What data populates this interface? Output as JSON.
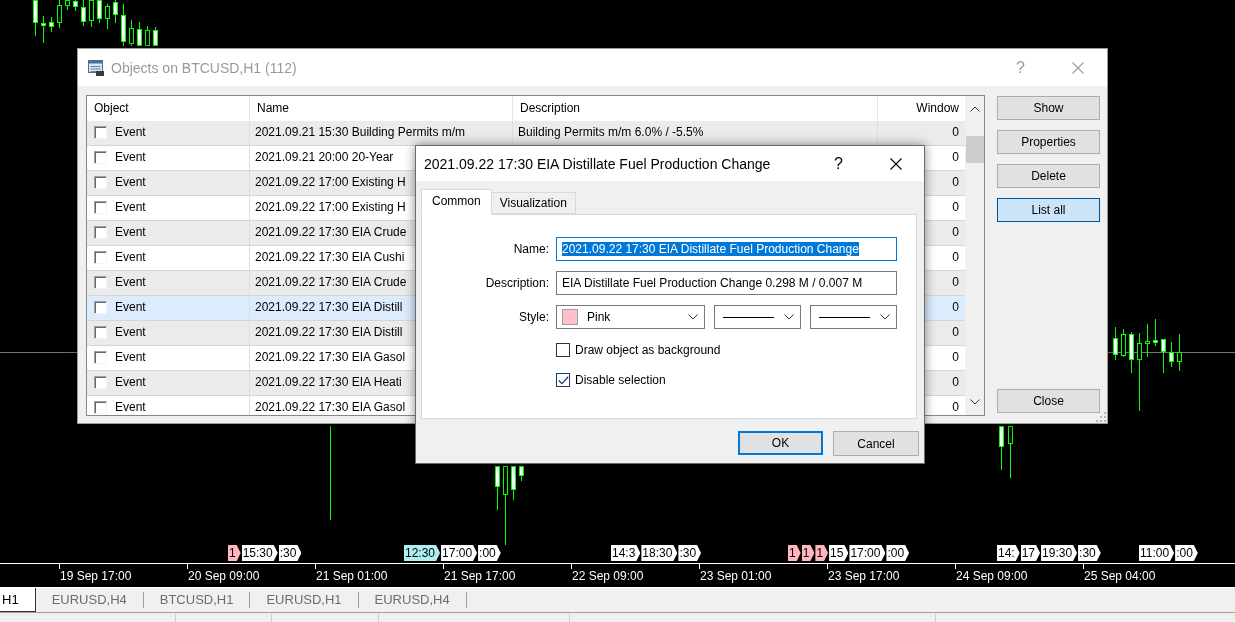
{
  "objects_window": {
    "title": "Objects on BTCUSD,H1 (112)",
    "active": false,
    "help": "?",
    "columns": [
      "Object",
      "Name",
      "Description",
      "Window"
    ],
    "rows": [
      {
        "object": "Event",
        "checked": false,
        "name": "2021.09.21 15:30 Building Permits m/m",
        "description": "Building Permits m/m 6.0% / -5.5%",
        "window": "0",
        "selected": false
      },
      {
        "object": "Event",
        "checked": false,
        "name": "2021.09.21 20:00 20-Year",
        "window": "0",
        "selected": false
      },
      {
        "object": "Event",
        "checked": false,
        "name": "2021.09.22 17:00 Existing H",
        "window": "0",
        "selected": false
      },
      {
        "object": "Event",
        "checked": false,
        "name": "2021.09.22 17:00 Existing H",
        "window": "0",
        "selected": false
      },
      {
        "object": "Event",
        "checked": false,
        "name": "2021.09.22 17:30 EIA Crude",
        "window": "0",
        "selected": false
      },
      {
        "object": "Event",
        "checked": false,
        "name": "2021.09.22 17:30 EIA Cushi",
        "window": "0",
        "selected": false
      },
      {
        "object": "Event",
        "checked": false,
        "name": "2021.09.22 17:30 EIA Crude",
        "window": "0",
        "selected": false
      },
      {
        "object": "Event",
        "checked": false,
        "name": "2021.09.22 17:30 EIA Distill",
        "window": "0",
        "selected": true
      },
      {
        "object": "Event",
        "checked": false,
        "name": "2021.09.22 17:30 EIA Distill",
        "window": "0",
        "selected": false
      },
      {
        "object": "Event",
        "checked": false,
        "name": "2021.09.22 17:30 EIA Gasol",
        "window": "0",
        "selected": false
      },
      {
        "object": "Event",
        "checked": false,
        "name": "2021.09.22 17:30 EIA Heati",
        "window": "0",
        "selected": false
      },
      {
        "object": "Event",
        "checked": false,
        "name": "2021.09.22 17:30 EIA Gasol",
        "window": "0",
        "selected": false
      }
    ],
    "buttons": [
      {
        "label": "Show",
        "focused": false
      },
      {
        "label": "Properties",
        "focused": false
      },
      {
        "label": "Delete",
        "focused": false
      },
      {
        "label": "List all",
        "focused": true
      },
      {
        "label": "Close",
        "focused": false
      }
    ]
  },
  "properties_dialog": {
    "title": "2021.09.22 17:30 EIA Distillate Fuel Production Change",
    "active": true,
    "help": "?",
    "tabs": [
      {
        "label": "Common",
        "selected": true
      },
      {
        "label": "Visualization",
        "selected": false
      }
    ],
    "fields": [
      {
        "label": "Name:",
        "value": "2021.09.22 17:30 EIA Distillate Fuel Production Change",
        "focused": true,
        "text_selected": true
      },
      {
        "label": "Description:",
        "value": "EIA Distillate Fuel Production Change 0.298 M / 0.007 M",
        "focused": false,
        "text_selected": false
      }
    ],
    "style": {
      "label": "Style:",
      "dropdowns": [
        {
          "kind": "color",
          "value": "Pink",
          "color": "#ffc0cb"
        },
        {
          "kind": "line"
        },
        {
          "kind": "line"
        }
      ]
    },
    "checkboxes": [
      {
        "label": "Draw object as background",
        "checked": false
      },
      {
        "label": "Disable selection",
        "checked": true
      }
    ],
    "buttons": [
      {
        "label": "OK",
        "default": true
      },
      {
        "label": "Cancel",
        "default": false
      }
    ]
  },
  "chart": {
    "event_tags": [
      {
        "items": [
          {
            "text": "1",
            "color": "#ffb6c1"
          },
          {
            "text": "15:30",
            "color": "#ffffff"
          },
          {
            "text": ":30",
            "color": "#ffffff"
          }
        ]
      },
      {
        "items": [
          {
            "text": "12:30",
            "color": "#afeeee"
          },
          {
            "text": "17:00",
            "color": "#ffffff"
          },
          {
            "text": ":00",
            "color": "#ffffff"
          }
        ]
      },
      {
        "items": [
          {
            "text": "14:3",
            "color": "#ffffff"
          },
          {
            "text": "18:30",
            "color": "#ffffff"
          },
          {
            "text": ":30",
            "color": "#ffffff"
          }
        ]
      },
      {
        "items": [
          {
            "text": "1",
            "color": "#ffb6c1"
          },
          {
            "text": "1",
            "color": "#ffb6c1"
          },
          {
            "text": "1",
            "color": "#ffb6c1"
          },
          {
            "text": "15",
            "color": "#ffffff"
          },
          {
            "text": "17:00",
            "color": "#ffffff"
          },
          {
            "text": ":00",
            "color": "#ffffff"
          }
        ]
      },
      {
        "items": [
          {
            "text": "14:",
            "color": "#ffffff"
          },
          {
            "text": "17",
            "color": "#ffffff"
          },
          {
            "text": "19:30",
            "color": "#ffffff"
          },
          {
            "text": ":30",
            "color": "#ffffff"
          }
        ]
      },
      {
        "items": [
          {
            "text": "11:00",
            "color": "#ffffff"
          },
          {
            "text": ":00",
            "color": "#ffffff"
          }
        ]
      }
    ],
    "time_axis": [
      "19 Sep 17:00",
      "20 Sep 09:00",
      "21 Sep 01:00",
      "21 Sep 17:00",
      "22 Sep 09:00",
      "23 Sep 01:00",
      "23 Sep 17:00",
      "24 Sep 09:00",
      "25 Sep 04:00"
    ]
  },
  "chart_tabs": [
    {
      "label": "H1",
      "selected": true
    },
    {
      "label": "EURUSD,H4",
      "selected": false
    },
    {
      "label": "BTCUSD,H1",
      "selected": false
    },
    {
      "label": "EURUSD,H1",
      "selected": false
    },
    {
      "label": "EURUSD,H4",
      "selected": false
    }
  ]
}
